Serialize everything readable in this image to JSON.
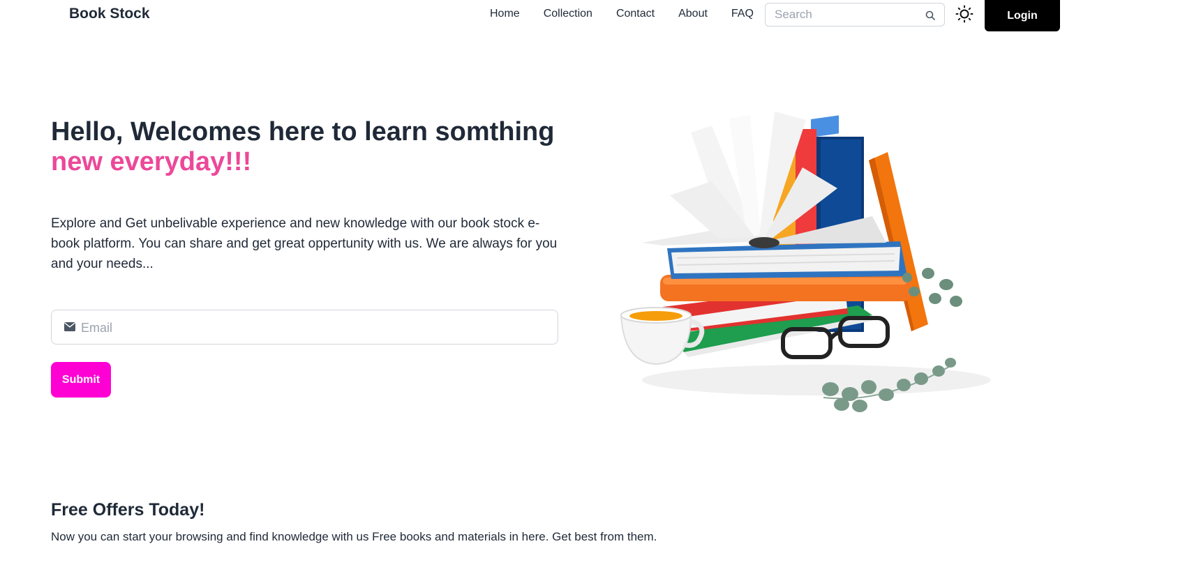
{
  "navbar": {
    "brand": "Book Stock",
    "links": [
      "Home",
      "Collection",
      "Contact",
      "About",
      "FAQ"
    ],
    "search_placeholder": "Search",
    "theme_icon": "sun-icon",
    "login_label": "Login"
  },
  "hero": {
    "title_line1": "Hello, Welcomes here to learn somthing",
    "title_line2": "new everyday!!!",
    "description": "Explore and Get unbelivable experience and new knowledge with our book stock e-book platform. You can share and get great oppertunity with us. We are always for you and your needs...",
    "email_placeholder": "Email",
    "email_icon": "envelope-icon",
    "submit_label": "Submit"
  },
  "offers": {
    "title": "Free Offers Today!",
    "description": "Now you can start your browsing and find knowledge with us Free books and materials in here. Get best from them."
  },
  "colors": {
    "accent_pink": "#ec4899",
    "submit_magenta": "#ff00d4",
    "login_black": "#000000",
    "text_dark": "#1f2937"
  }
}
